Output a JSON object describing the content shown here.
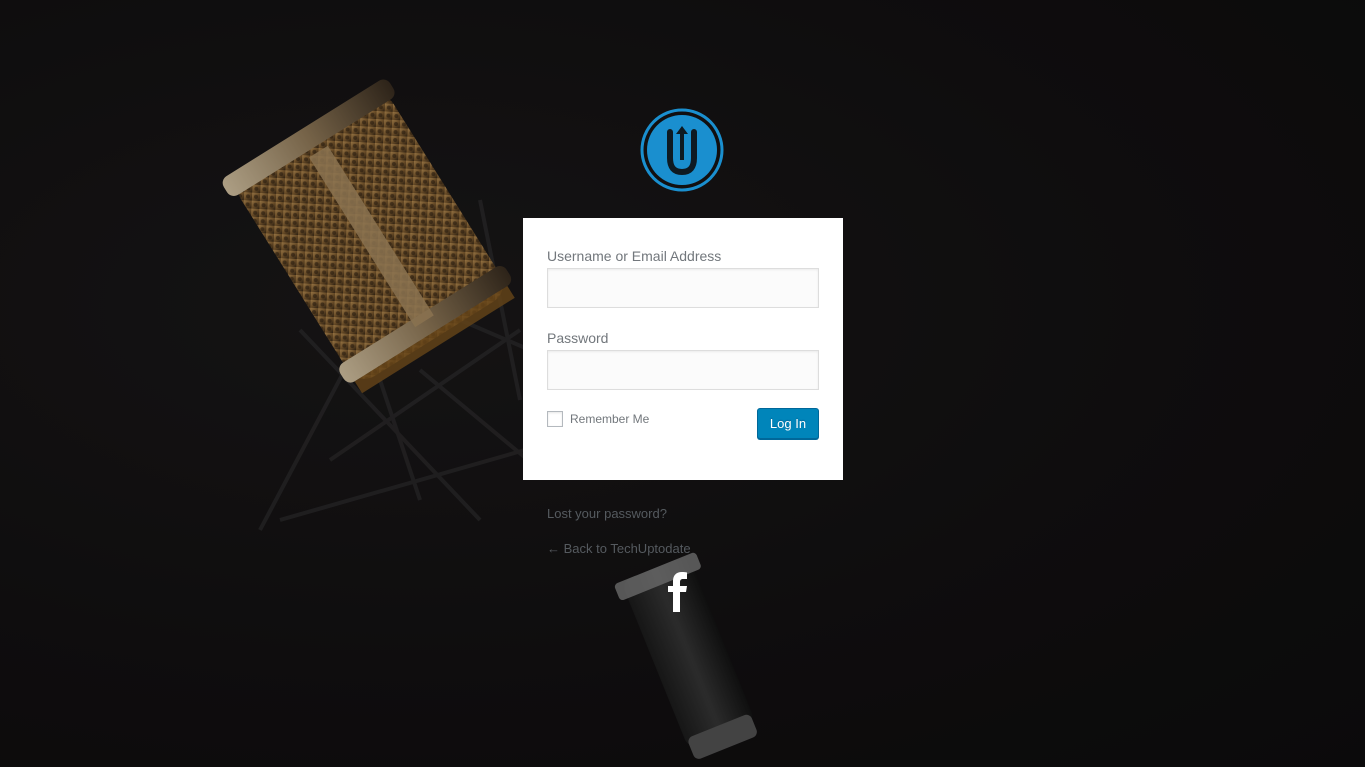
{
  "page": {
    "site_name": "TechUptodate"
  },
  "logo": {
    "icon": "techuptodate-logo-icon",
    "accent_color": "#1a8fcf"
  },
  "form": {
    "username_label": "Username or Email Address",
    "username_value": "",
    "password_label": "Password",
    "password_value": "",
    "remember_label": "Remember Me",
    "remember_checked": false,
    "submit_label": "Log In",
    "submit_color": "#0085ba"
  },
  "links": {
    "lost_password": "Lost your password?",
    "back_to_site": "← Back to TechUptodate"
  },
  "social": {
    "icon": "facebook-icon"
  }
}
